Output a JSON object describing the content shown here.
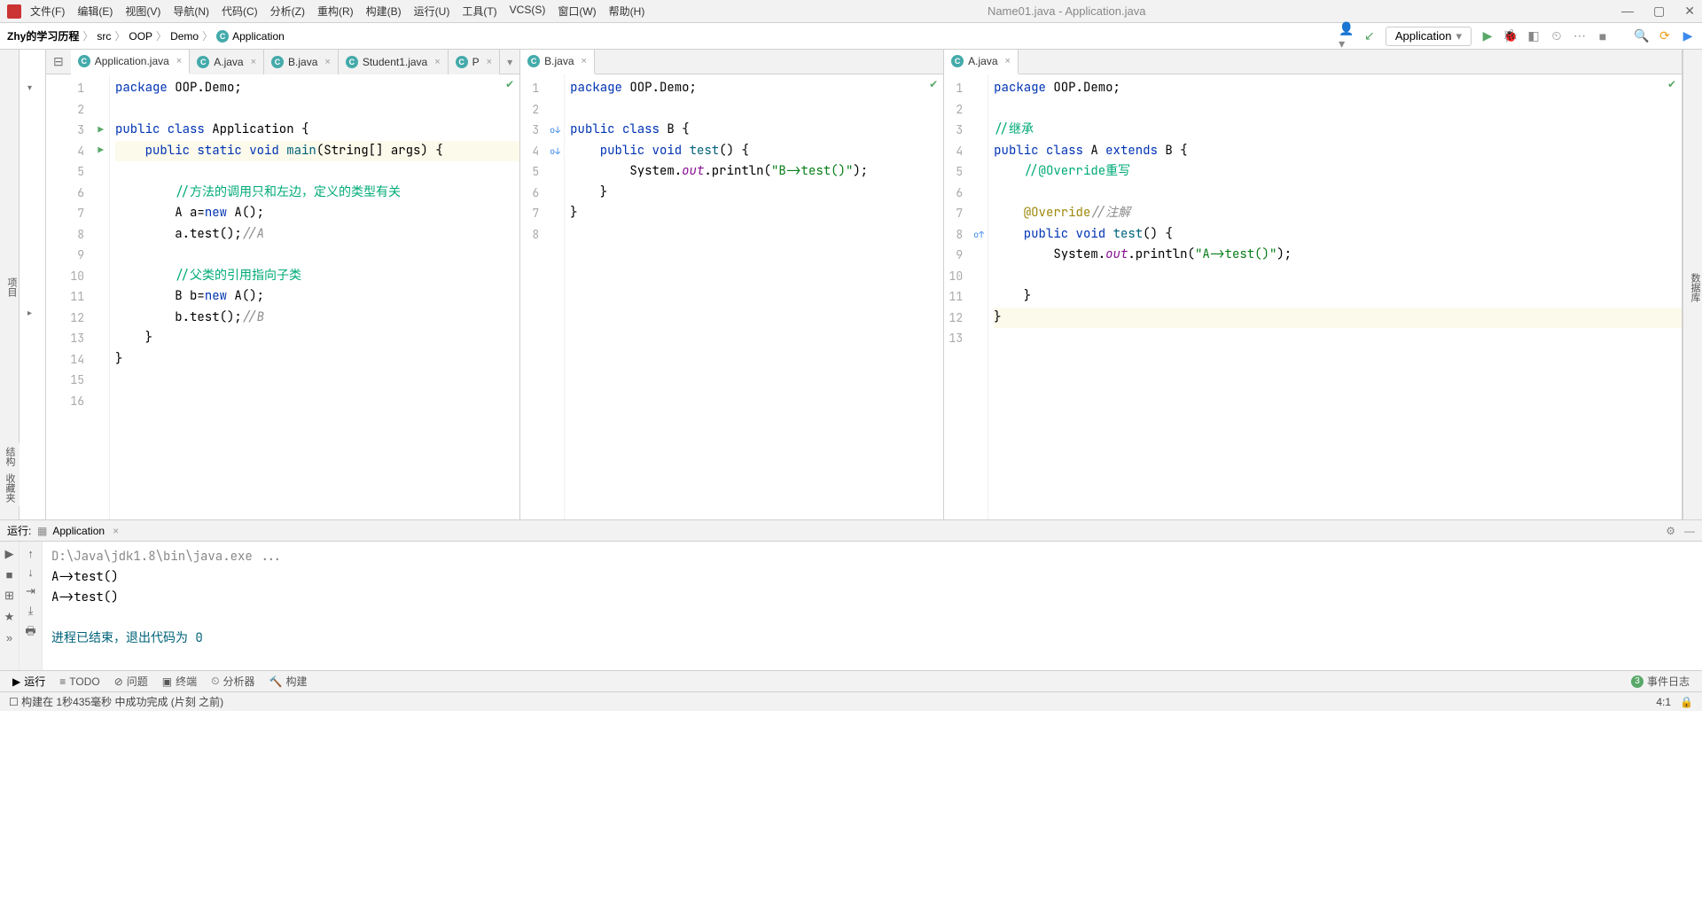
{
  "window": {
    "title": "Name01.java - Application.java"
  },
  "menu": [
    "文件(F)",
    "编辑(E)",
    "视图(V)",
    "导航(N)",
    "代码(C)",
    "分析(Z)",
    "重构(R)",
    "构建(B)",
    "运行(U)",
    "工具(T)",
    "VCS(S)",
    "窗口(W)",
    "帮助(H)"
  ],
  "breadcrumb": {
    "project": "Zhy的学习历程",
    "parts": [
      "src",
      "OOP",
      "Demo",
      "Application"
    ]
  },
  "run_config": "Application",
  "left_tool": {
    "project_label": "项目"
  },
  "right_tool": {
    "db_label": "数据库"
  },
  "tabs_pane1": [
    {
      "label": "Application.java",
      "active": true
    },
    {
      "label": "A.java",
      "active": false
    },
    {
      "label": "B.java",
      "active": false
    },
    {
      "label": "Student1.java",
      "active": false
    },
    {
      "label": "P",
      "active": false
    }
  ],
  "tabs_pane2": [
    {
      "label": "B.java",
      "active": true
    }
  ],
  "tabs_pane3": [
    {
      "label": "A.java",
      "active": true
    }
  ],
  "editor1": {
    "lines": 16,
    "highlight": 4,
    "code": [
      [
        {
          "t": "package ",
          "c": "kw"
        },
        {
          "t": "OOP.Demo;",
          "c": ""
        }
      ],
      [],
      [
        {
          "t": "public class ",
          "c": "kw"
        },
        {
          "t": "Application {",
          "c": ""
        }
      ],
      [
        {
          "t": "    ",
          "c": ""
        },
        {
          "t": "public static void ",
          "c": "kw"
        },
        {
          "t": "main",
          "c": "nm"
        },
        {
          "t": "(String[] args) {",
          "c": ""
        }
      ],
      [],
      [
        {
          "t": "        ",
          "c": ""
        },
        {
          "t": "//方法的调用只和左边，定义的类型有关",
          "c": "cm-bold"
        }
      ],
      [
        {
          "t": "        A a=",
          "c": ""
        },
        {
          "t": "new ",
          "c": "kw"
        },
        {
          "t": "A();",
          "c": ""
        }
      ],
      [
        {
          "t": "        a.test();",
          "c": ""
        },
        {
          "t": "//A",
          "c": "cm"
        }
      ],
      [],
      [
        {
          "t": "        ",
          "c": ""
        },
        {
          "t": "//父类的引用指向子类",
          "c": "cm-bold"
        }
      ],
      [
        {
          "t": "        B b=",
          "c": ""
        },
        {
          "t": "new ",
          "c": "kw"
        },
        {
          "t": "A();",
          "c": ""
        }
      ],
      [
        {
          "t": "        b.test();",
          "c": ""
        },
        {
          "t": "//B",
          "c": "cm"
        }
      ],
      [
        {
          "t": "    }",
          "c": ""
        }
      ],
      [
        {
          "t": "}",
          "c": ""
        }
      ],
      [],
      []
    ]
  },
  "editor2": {
    "lines": 8,
    "code": [
      [
        {
          "t": "package ",
          "c": "kw"
        },
        {
          "t": "OOP.Demo;",
          "c": ""
        }
      ],
      [],
      [
        {
          "t": "public class ",
          "c": "kw"
        },
        {
          "t": "B {",
          "c": ""
        }
      ],
      [
        {
          "t": "    ",
          "c": ""
        },
        {
          "t": "public void ",
          "c": "kw"
        },
        {
          "t": "test",
          "c": "nm"
        },
        {
          "t": "() {",
          "c": ""
        }
      ],
      [
        {
          "t": "        System.",
          "c": ""
        },
        {
          "t": "out",
          "c": "fld"
        },
        {
          "t": ".println(",
          "c": ""
        },
        {
          "t": "\"B->test()\"",
          "c": "st"
        },
        {
          "t": ");",
          "c": ""
        }
      ],
      [
        {
          "t": "    }",
          "c": ""
        }
      ],
      [
        {
          "t": "}",
          "c": ""
        }
      ],
      []
    ]
  },
  "editor3": {
    "lines": 13,
    "highlight": 12,
    "code": [
      [
        {
          "t": "package ",
          "c": "kw"
        },
        {
          "t": "OOP.Demo;",
          "c": ""
        }
      ],
      [],
      [
        {
          "t": "//继承",
          "c": "cm-bold"
        }
      ],
      [
        {
          "t": "public class ",
          "c": "kw"
        },
        {
          "t": "A ",
          "c": ""
        },
        {
          "t": "extends ",
          "c": "kw"
        },
        {
          "t": "B {",
          "c": ""
        }
      ],
      [
        {
          "t": "    ",
          "c": ""
        },
        {
          "t": "//@Override重写",
          "c": "cm-bold"
        }
      ],
      [],
      [
        {
          "t": "    ",
          "c": ""
        },
        {
          "t": "@Override",
          "c": "an"
        },
        {
          "t": "//注解",
          "c": "cm"
        }
      ],
      [
        {
          "t": "    ",
          "c": ""
        },
        {
          "t": "public void ",
          "c": "kw"
        },
        {
          "t": "test",
          "c": "nm"
        },
        {
          "t": "() {",
          "c": ""
        }
      ],
      [
        {
          "t": "        System.",
          "c": ""
        },
        {
          "t": "out",
          "c": "fld"
        },
        {
          "t": ".println(",
          "c": ""
        },
        {
          "t": "\"A->test()\"",
          "c": "st"
        },
        {
          "t": ");",
          "c": ""
        }
      ],
      [],
      [
        {
          "t": "    }",
          "c": ""
        }
      ],
      [
        {
          "t": "}",
          "c": ""
        }
      ],
      []
    ]
  },
  "run": {
    "label": "运行:",
    "config": "Application",
    "out_cmd": "D:\\Java\\jdk1.8\\bin\\java.exe ...",
    "out1": "A->test()",
    "out2": "A->test()",
    "exit": "进程已结束，退出代码为 0"
  },
  "bottom_tabs": {
    "run": "运行",
    "todo": "TODO",
    "prob": "问题",
    "term": "终端",
    "prof": "分析器",
    "build": "构建",
    "events": "事件日志"
  },
  "left_vertical": {
    "struct": "结构",
    "fav": "收藏夹"
  },
  "status": {
    "msg": "构建在 1秒435毫秒 中成功完成 (片刻 之前)",
    "caret": "4:1"
  }
}
